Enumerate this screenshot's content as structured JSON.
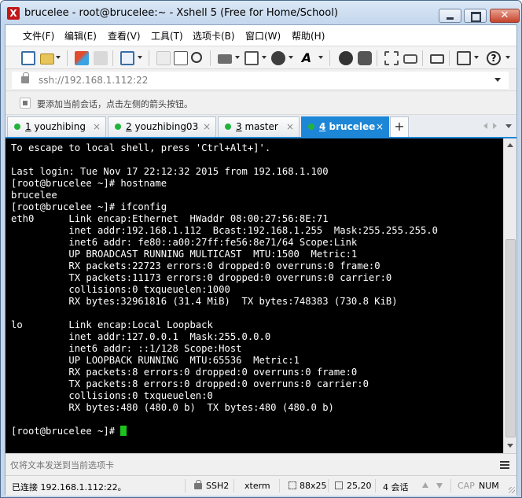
{
  "window": {
    "title": "brucelee - root@brucelee:~ - Xshell 5 (Free for Home/School)",
    "app_icon": "xshell-logo-icon",
    "close_glyph": "✕",
    "colors": {
      "titlebar": "#c6d7ea",
      "active_tab": "#1e86d6",
      "terminal_bg": "#000000",
      "cursor": "#1ec31e"
    }
  },
  "menubar": {
    "items": [
      "文件(F)",
      "编辑(E)",
      "查看(V)",
      "工具(T)",
      "选项卡(B)",
      "窗口(W)",
      "帮助(H)"
    ]
  },
  "toolbar": {
    "icons": [
      "new-session-icon",
      "open-folder-icon",
      "reconnect-icon",
      "disconnect-icon",
      "properties-icon",
      "copy-icon",
      "paste-icon",
      "find-icon",
      "print-icon",
      "transfer-icon",
      "globe-icon",
      "font-icon",
      "xftp-icon",
      "xmanager-icon",
      "fullscreen-icon",
      "lock-icon",
      "keyboard-icon",
      "add-icon",
      "help-icon"
    ]
  },
  "address": {
    "value": "ssh://192.168.1.112:22"
  },
  "hint": {
    "text": "要添加当前会话，点击左侧的箭头按钮。"
  },
  "tabs": [
    {
      "num": "1",
      "label": "youzhibing",
      "active": false
    },
    {
      "num": "2",
      "label": "youzhibing03",
      "active": false
    },
    {
      "num": "3",
      "label": "master",
      "active": false
    },
    {
      "num": "4",
      "label": "brucelee",
      "active": true
    }
  ],
  "tab_close_glyph": "×",
  "tab_add_glyph": "+",
  "terminal": {
    "lines": [
      "To escape to local shell, press 'Ctrl+Alt+]'.",
      "",
      "Last login: Tue Nov 17 22:12:32 2015 from 192.168.1.100",
      "[root@brucelee ~]# hostname",
      "brucelee",
      "[root@brucelee ~]# ifconfig",
      "eth0      Link encap:Ethernet  HWaddr 08:00:27:56:8E:71",
      "          inet addr:192.168.1.112  Bcast:192.168.1.255  Mask:255.255.255.0",
      "          inet6 addr: fe80::a00:27ff:fe56:8e71/64 Scope:Link",
      "          UP BROADCAST RUNNING MULTICAST  MTU:1500  Metric:1",
      "          RX packets:22723 errors:0 dropped:0 overruns:0 frame:0",
      "          TX packets:11173 errors:0 dropped:0 overruns:0 carrier:0",
      "          collisions:0 txqueuelen:1000",
      "          RX bytes:32961816 (31.4 MiB)  TX bytes:748383 (730.8 KiB)",
      "",
      "lo        Link encap:Local Loopback",
      "          inet addr:127.0.0.1  Mask:255.0.0.0",
      "          inet6 addr: ::1/128 Scope:Host",
      "          UP LOOPBACK RUNNING  MTU:65536  Metric:1",
      "          RX packets:8 errors:0 dropped:0 overruns:0 frame:0",
      "          TX packets:8 errors:0 dropped:0 overruns:0 carrier:0",
      "          collisions:0 txqueuelen:0",
      "          RX bytes:480 (480.0 b)  TX bytes:480 (480.0 b)",
      ""
    ],
    "prompt": "[root@brucelee ~]# "
  },
  "compose": {
    "placeholder": "仅将文本发送到当前选项卡"
  },
  "status": {
    "connection": "已连接 192.168.1.112:22。",
    "protocol": "SSH2",
    "terminal_type": "xterm",
    "size": "88x25",
    "cursor_pos": "25,20",
    "sessions": "4 会话",
    "caps": "CAP",
    "num": "NUM"
  }
}
